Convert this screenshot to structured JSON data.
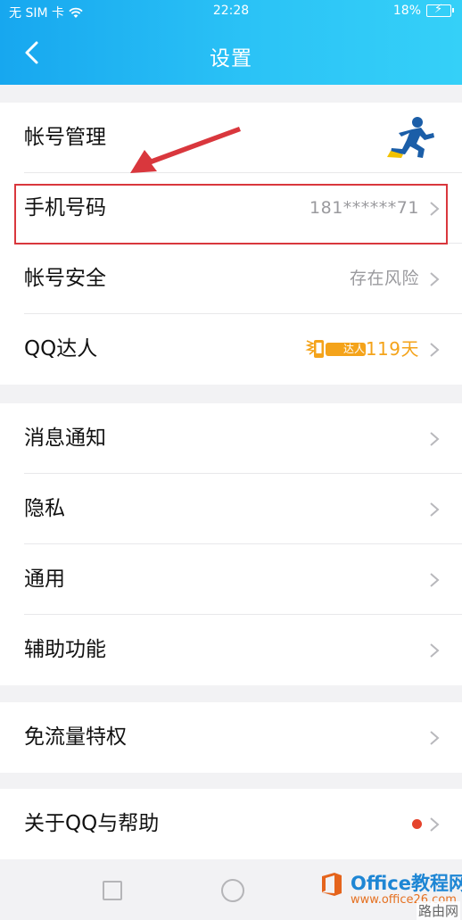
{
  "status_bar": {
    "carrier": "无 SIM 卡",
    "time": "22:28",
    "battery": "18%"
  },
  "header": {
    "title": "设置"
  },
  "groups": [
    {
      "rows": [
        {
          "label": "帐号管理",
          "value": ""
        },
        {
          "label": "手机号码",
          "value": "181******71"
        },
        {
          "label": "帐号安全",
          "value": "存在风险"
        },
        {
          "label": "QQ达人",
          "value": "119天",
          "badge": "达人"
        }
      ]
    },
    {
      "rows": [
        {
          "label": "消息通知"
        },
        {
          "label": "隐私"
        },
        {
          "label": "通用"
        },
        {
          "label": "辅助功能"
        }
      ]
    },
    {
      "rows": [
        {
          "label": "免流量特权"
        }
      ]
    },
    {
      "rows": [
        {
          "label": "关于QQ与帮助"
        }
      ]
    }
  ],
  "watermark": {
    "main": "Office教程网",
    "sub": "www.office26.com",
    "corner": "路由网"
  },
  "colors": {
    "header_start": "#17a7ef",
    "header_end": "#35d0f8",
    "highlight": "#d9373d",
    "notification_dot": "#e5432c",
    "expert_days": "#f4a31a"
  },
  "icons": [
    "wifi-icon",
    "battery-icon",
    "back-arrow-icon",
    "qq-runner-icon",
    "chevron-right-icon",
    "expert-badge-icon",
    "square-nav-icon",
    "circle-nav-icon"
  ]
}
